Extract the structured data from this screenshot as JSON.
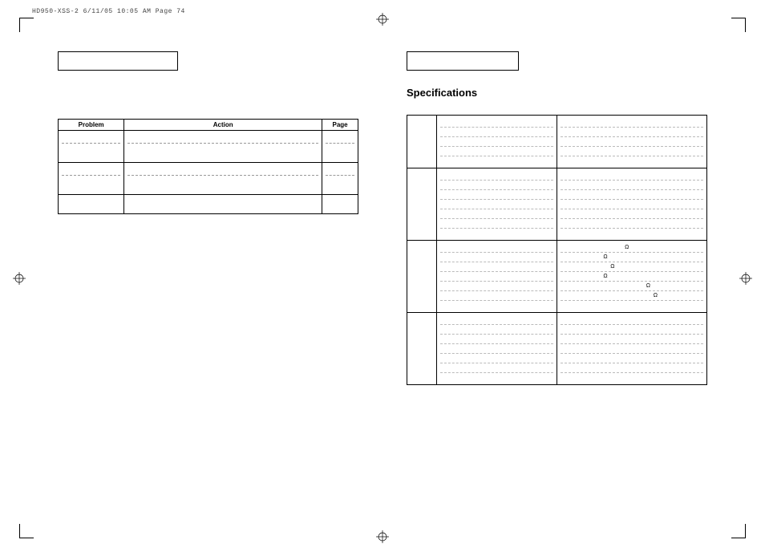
{
  "print_header": "HD950-XSS-2  6/11/05  10:05 AM  Page 74",
  "left_page": {
    "table": {
      "headers": {
        "problem": "Problem",
        "action": "Action",
        "page": "Page"
      }
    }
  },
  "right_page": {
    "section_title": "Specifications",
    "ohm_symbol": "Ω"
  }
}
